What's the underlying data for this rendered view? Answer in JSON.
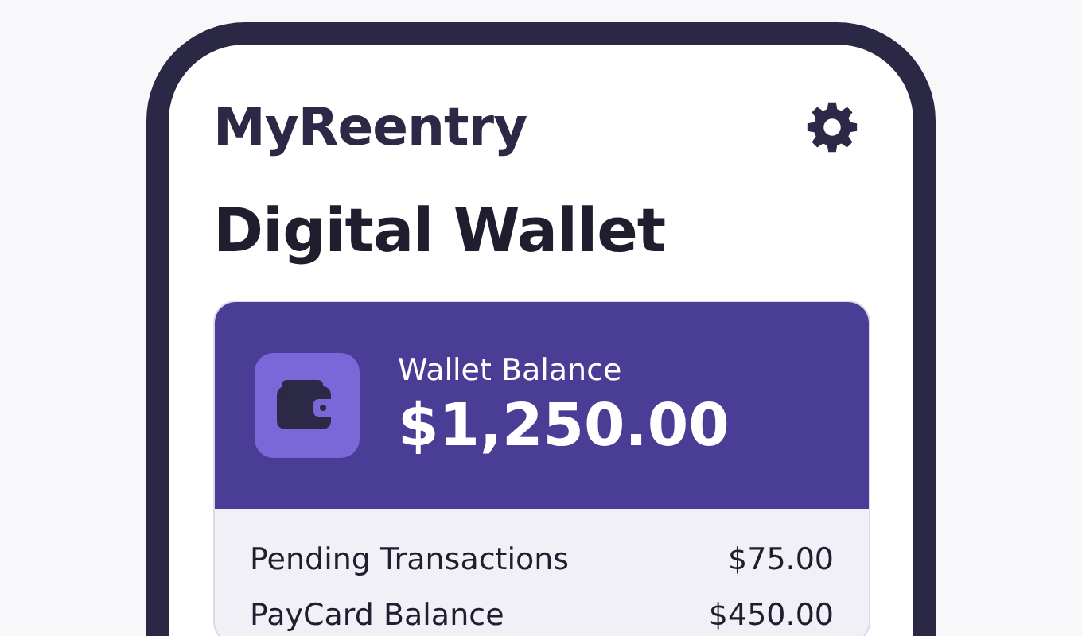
{
  "app": {
    "title": "MyReentry"
  },
  "page": {
    "title": "Digital Wallet"
  },
  "wallet": {
    "label": "Wallet Balance",
    "amount": "$1,250.00"
  },
  "rows": [
    {
      "label": "Pending Transactions",
      "value": "$75.00"
    },
    {
      "label": "PayCard Balance",
      "value": "$450.00"
    }
  ]
}
